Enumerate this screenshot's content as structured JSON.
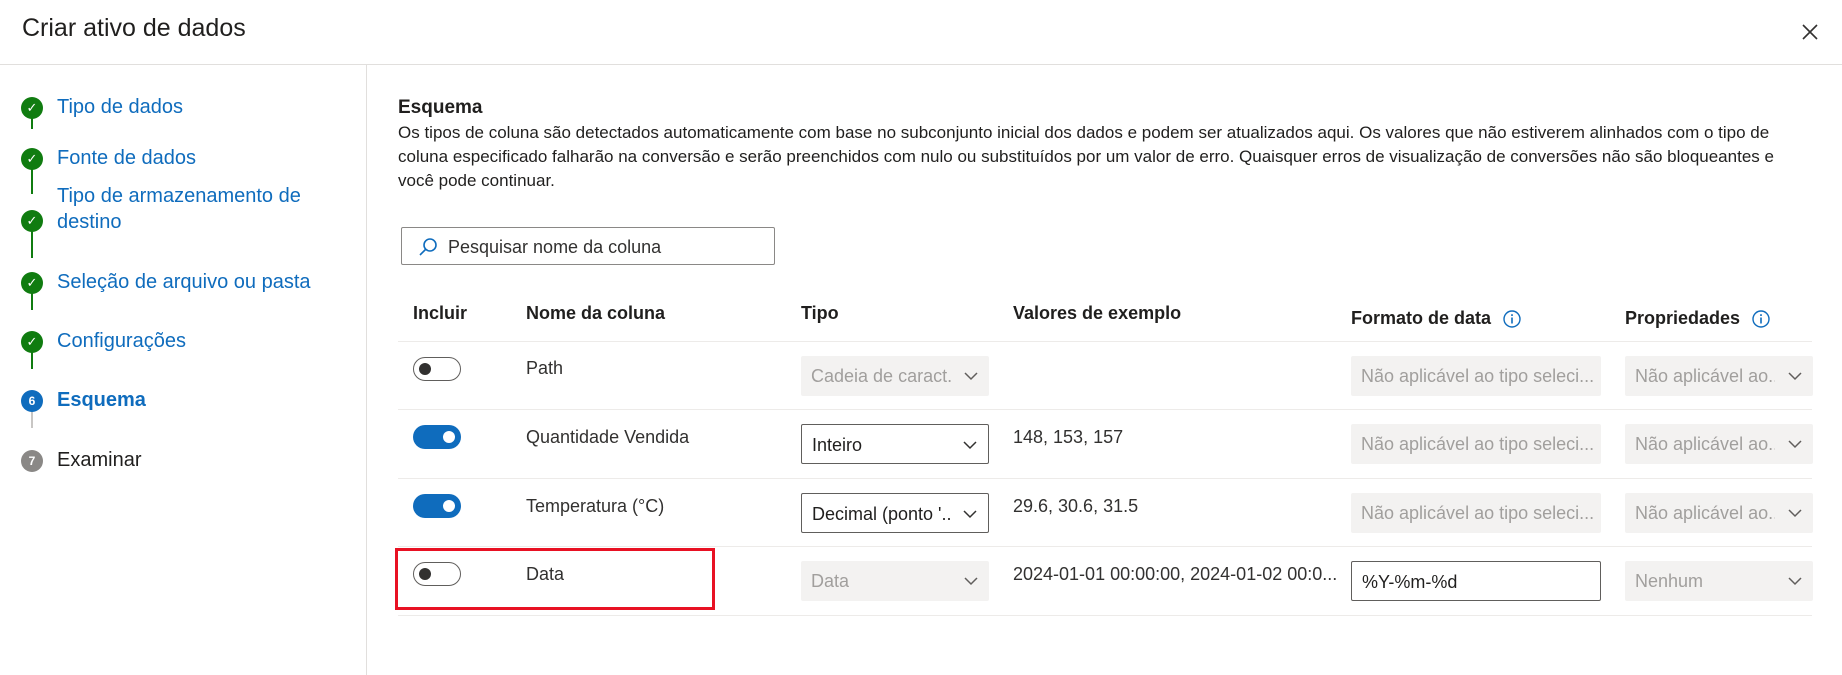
{
  "dialog": {
    "title": "Criar ativo de dados"
  },
  "steps": [
    {
      "label": "Tipo de dados",
      "status": "done"
    },
    {
      "label": "Fonte de dados",
      "status": "done"
    },
    {
      "label": "Tipo de armazenamento de destino",
      "status": "done"
    },
    {
      "label": "Seleção de arquivo ou pasta",
      "status": "done"
    },
    {
      "label": "Configurações",
      "status": "done"
    },
    {
      "label": "Esquema",
      "status": "current",
      "number": "6"
    },
    {
      "label": "Examinar",
      "status": "pending",
      "number": "7"
    }
  ],
  "schema": {
    "title": "Esquema",
    "description": "Os tipos de coluna são detectados automaticamente com base no subconjunto inicial dos dados e podem ser atualizados aqui. Os valores que não estiverem alinhados com o tipo de coluna especificado falharão na conversão e serão preenchidos com nulo ou substituídos por um valor de erro. Quaisquer erros de visualização de conversões não são bloqueantes e você pode continuar.",
    "search_placeholder": "Pesquisar nome da coluna"
  },
  "table": {
    "headers": {
      "include": "Incluir",
      "name": "Nome da coluna",
      "type": "Tipo",
      "sample": "Valores de exemplo",
      "date_format": "Formato de data",
      "properties": "Propriedades"
    },
    "rows": [
      {
        "include": false,
        "name": "Path",
        "type": "Cadeia de caract...",
        "type_enabled": false,
        "sample": "",
        "date_format": "Não aplicável ao tipo seleci...",
        "date_format_enabled": false,
        "properties": "Não aplicável ao..."
      },
      {
        "include": true,
        "name": "Quantidade Vendida",
        "type": "Inteiro",
        "type_enabled": true,
        "sample": "148, 153, 157",
        "date_format": "Não aplicável ao tipo seleci...",
        "date_format_enabled": false,
        "properties": "Não aplicável ao..."
      },
      {
        "include": true,
        "name": "Temperatura (°C)",
        "type": "Decimal (ponto '...",
        "type_enabled": true,
        "sample": "29.6, 30.6, 31.5",
        "date_format": "Não aplicável ao tipo seleci...",
        "date_format_enabled": false,
        "properties": "Não aplicável ao..."
      },
      {
        "include": false,
        "name": "Data",
        "type": "Data",
        "type_enabled": false,
        "sample": "2024-01-01 00:00:00, 2024-01-02 00:0...",
        "date_format": "%Y-%m-%d",
        "date_format_enabled": true,
        "properties": "Nenhum"
      }
    ]
  },
  "colors": {
    "accent": "#0f6cbd",
    "success": "#107c10",
    "highlight": "#e81123"
  }
}
